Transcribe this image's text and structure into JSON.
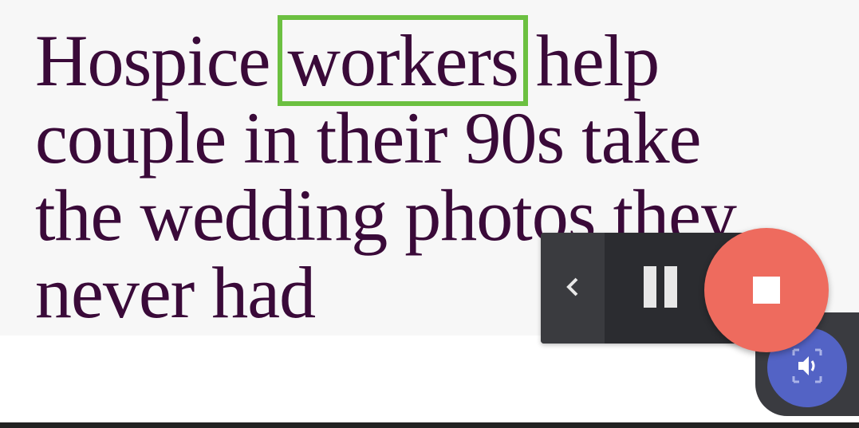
{
  "article": {
    "headline_lines": [
      {
        "before": "Hospice ",
        "highlighted": "workers",
        "after": " help"
      },
      {
        "text": "couple in their 90s take"
      },
      {
        "text": "the wedding photos they"
      },
      {
        "text": "never had"
      }
    ]
  },
  "colors": {
    "headline_text": "#3a0a39",
    "highlight_border": "#6cc041",
    "panel_background": "#2b2c30",
    "stop_button": "#ee6b5e",
    "speak_button": "#5363c5"
  },
  "tts_controls": {
    "collapse_icon": "chevron-left-icon",
    "pause_icon": "pause-icon",
    "stop_icon": "stop-icon",
    "speak_icon": "speaker-icon"
  }
}
